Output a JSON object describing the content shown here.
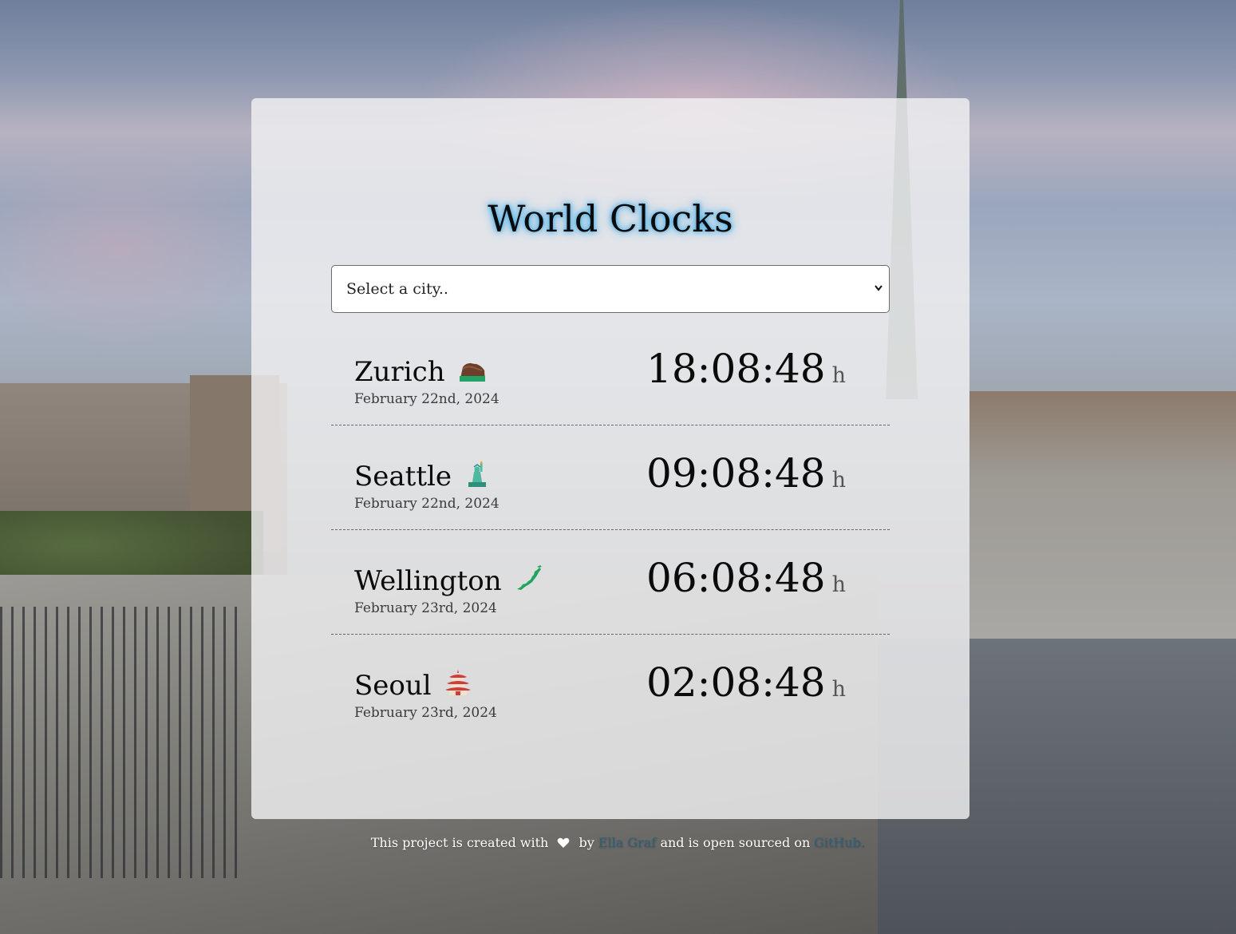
{
  "page": {
    "title": "World Clocks"
  },
  "selector": {
    "placeholder": "Select a city.."
  },
  "clocks": [
    {
      "city": "Zurich",
      "icon": "chocolate-bar-icon",
      "date": "February 22nd, 2024",
      "time": "18:08:48",
      "unit": "h"
    },
    {
      "city": "Seattle",
      "icon": "statue-of-liberty-icon",
      "date": "February 22nd, 2024",
      "time": "09:08:48",
      "unit": "h"
    },
    {
      "city": "Wellington",
      "icon": "map-of-japan-icon",
      "date": "February 23rd, 2024",
      "time": "06:08:48",
      "unit": "h"
    },
    {
      "city": "Seoul",
      "icon": "pagoda-icon",
      "date": "February 23rd, 2024",
      "time": "02:08:48",
      "unit": "h"
    }
  ],
  "footer": {
    "text_before": "This project is created with",
    "icon": "heart-icon",
    "by": "by",
    "author_link": "Ella Graf",
    "text_middle": "and is open sourced on",
    "repo_link": "GitHub."
  },
  "colors": {
    "title_glow": "#36a8e8",
    "link": "#2f5f78",
    "card_bg": "rgba(240,240,242,0.82)"
  }
}
